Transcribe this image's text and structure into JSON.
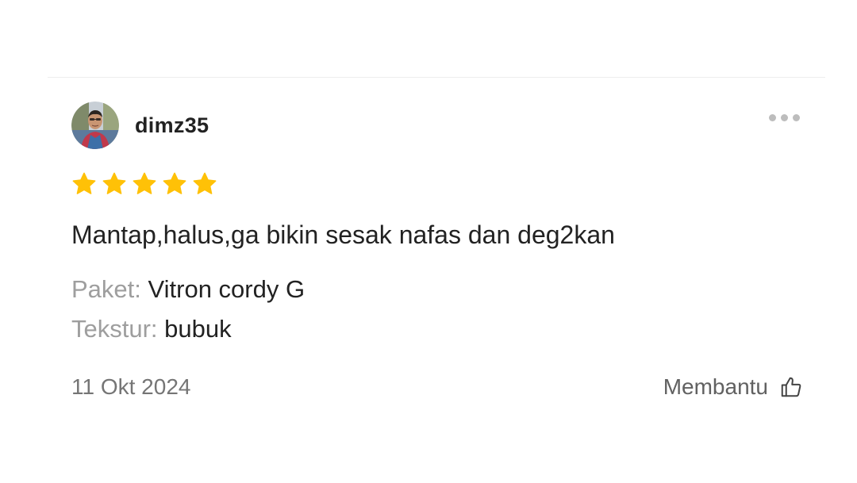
{
  "review": {
    "username": "dimz35",
    "avatar_icon": "user-photo-avatar",
    "more_icon": "more-horizontal-icon",
    "rating": 5,
    "rating_max": 5,
    "star_color": "#FFC107",
    "text": "Mantap,halus,ga bikin sesak nafas dan deg2kan",
    "variants": [
      {
        "label": "Paket:",
        "value": "Vitron cordy G"
      },
      {
        "label": "Tekstur:",
        "value": "bubuk"
      }
    ],
    "date": "11 Okt 2024",
    "helpful_label": "Membantu",
    "helpful_icon": "thumbs-up-icon"
  }
}
